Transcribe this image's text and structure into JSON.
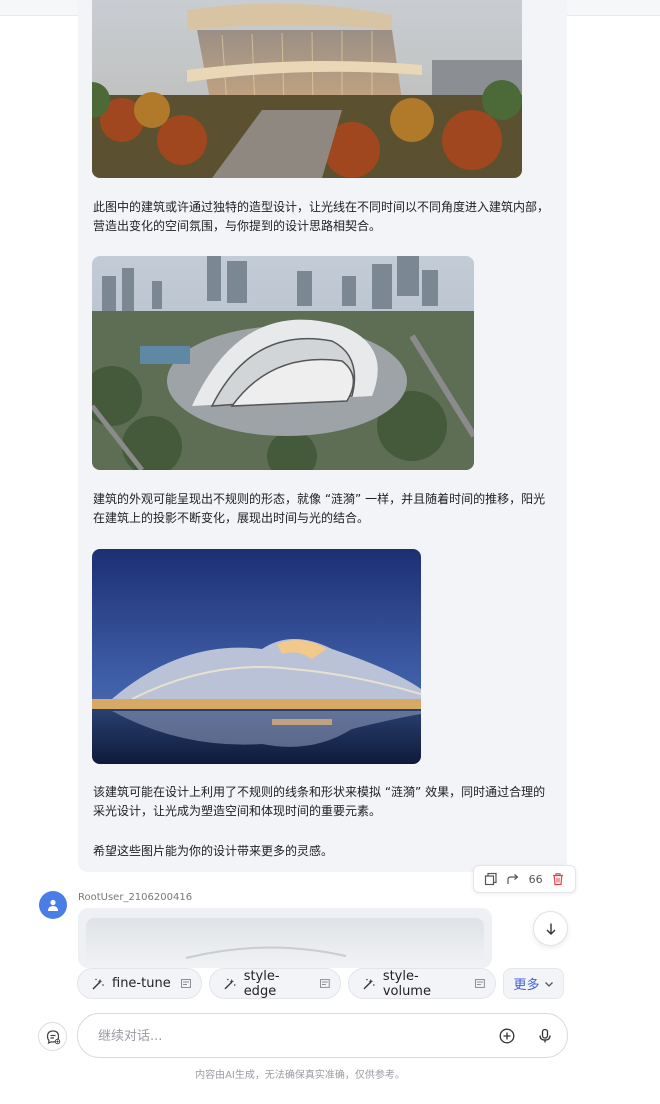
{
  "message": {
    "paragraphs": [
      "此图中的建筑或许通过独特的造型设计，让光线在不同时间以不同角度进入建筑内部，营造出变化的空间氛围，与你提到的设计思路相契合。",
      "建筑的外观可能呈现出不规则的形态，就像 “涟漪” 一样，并且随着时间的推移，阳光在建筑上的投影不断变化，展现出时间与光的结合。",
      "该建筑可能在设计上利用了不规则的线条和形状来模拟 “涟漪” 效果，同时通过合理的采光设计，让光成为塑造空间和体现时间的重要元素。",
      "希望这些图片能为你的设计带来更多的灵感。"
    ],
    "actions": {
      "quote_label": "66"
    }
  },
  "user": {
    "name": "RootUser_2106200416"
  },
  "suggestions": {
    "chips": [
      "fine-tune",
      "style-edge",
      "style-volume"
    ],
    "more_label": "更多"
  },
  "composer": {
    "placeholder": "继续对话..."
  },
  "disclaimer": "内容由AI生成，无法确保真实准确，仅供参考。"
}
